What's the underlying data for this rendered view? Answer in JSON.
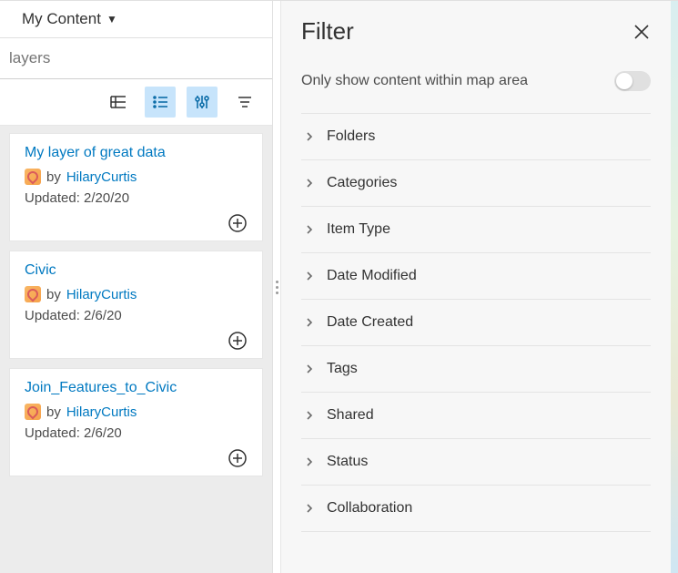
{
  "left": {
    "scope_dropdown": "My Content",
    "search_placeholder": "layers",
    "items": [
      {
        "title": "My layer of great data",
        "by_prefix": "by",
        "author": "HilaryCurtis",
        "updated": "Updated: 2/20/20"
      },
      {
        "title": "Civic",
        "by_prefix": "by",
        "author": "HilaryCurtis",
        "updated": "Updated: 2/6/20"
      },
      {
        "title": "Join_Features_to_Civic",
        "by_prefix": "by",
        "author": "HilaryCurtis",
        "updated": "Updated: 2/6/20"
      }
    ]
  },
  "filter": {
    "title": "Filter",
    "toggle_label": "Only show content within map area",
    "sections": [
      "Folders",
      "Categories",
      "Item Type",
      "Date Modified",
      "Date Created",
      "Tags",
      "Shared",
      "Status",
      "Collaboration"
    ]
  }
}
